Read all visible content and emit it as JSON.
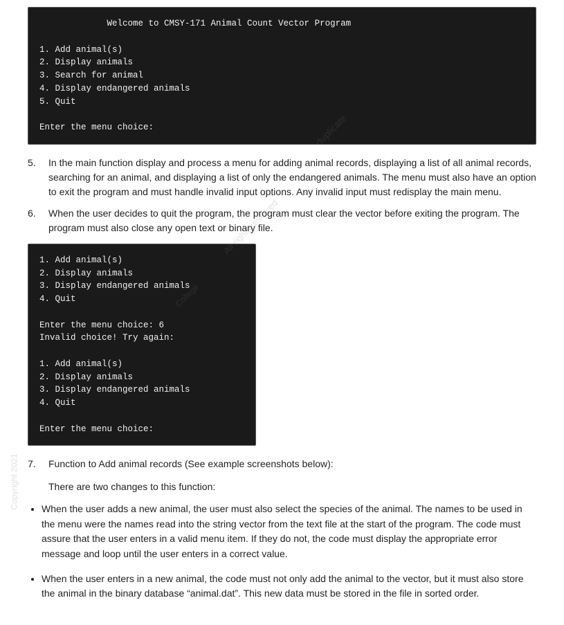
{
  "terminal_top": {
    "lines": [
      "             Welcome to CMSY-171 Animal Count Vector Program",
      "",
      "1. Add animal(s)",
      "2. Display animals",
      "3. Search for animal",
      "4. Display endangered animals",
      "5. Quit",
      "",
      "Enter the menu choice:"
    ]
  },
  "numbered_items": [
    {
      "num": "5.",
      "text": "In the main function display and process a menu for adding animal records, displaying a list of all animal records, searching for an animal, and displaying a list of only the endangered animals. The menu must also have an option to exit the program and must handle invalid input options. Any invalid input must redisplay the main menu."
    },
    {
      "num": "6.",
      "text": "When the user decides to quit the program, the program must clear the vector before exiting the program. The program must also close any open text or binary file."
    }
  ],
  "terminal_partial": {
    "lines": [
      "1. Add animal(s)",
      "2. Display animals",
      "3. Display endangered animals",
      "4. Quit",
      "",
      "Enter the menu choice: 6",
      "Invalid choice! Try again:",
      "",
      "1. Add animal(s)",
      "2. Display animals",
      "3. Display endangered animals",
      "4. Quit",
      "",
      "Enter the menu choice:"
    ]
  },
  "item7": {
    "num": "7.",
    "text": "Function to Add animal records (See example screenshots below):"
  },
  "two_changes": "There are two changes to this function:",
  "bullets": [
    {
      "text": "When the user adds a new animal, the user must also select the species of the animal.  The names to be used in the menu were the names read into the string vector from the text file at the start of the program.  The code must assure that the user enters in a valid menu item.  If they do not, the code must display the appropriate error message and loop until the user enters in a correct value."
    },
    {
      "text": "When the user enters in a new animal, the code must not only add the animal to the vector, but it must also store the animal in the binary database “animal.dat”. This new data must be stored in the file in sorted order."
    }
  ],
  "watermark": {
    "line1": "duplicate",
    "line2": "All rights reserved",
    "line3": "College",
    "copyright": "Copyright 2021"
  }
}
